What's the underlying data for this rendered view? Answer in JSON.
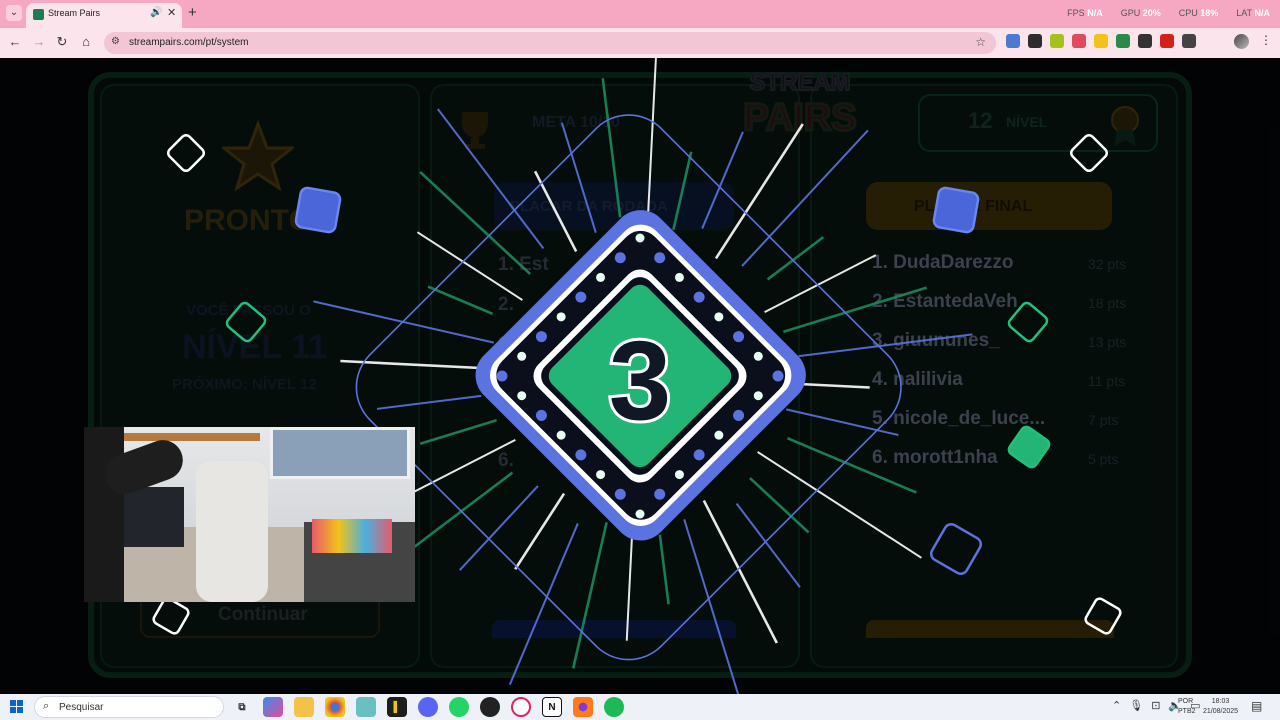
{
  "browser": {
    "tab_title": "Stream Pairs",
    "url": "streampairs.com/pt/system",
    "hud": {
      "fps_label": "FPS",
      "fps_value": "N/A",
      "gpu_label": "GPU",
      "gpu_value": "20%",
      "cpu_label": "CPU",
      "cpu_value": "18%",
      "lat_label": "LAT",
      "lat_value": "N/A"
    },
    "extension_colors": [
      "#4a7bd0",
      "#2d2d2d",
      "#a4c21a",
      "#e04a5a",
      "#f2c21a",
      "#2a8a4a",
      "#333333",
      "#d4201a",
      "#444444"
    ]
  },
  "game": {
    "countdown": "3",
    "ready_label": "PRONTO!",
    "level_passed_label": "VOCÊ PASSOU O",
    "level_label": "NÍVEL 11",
    "next_level_label": "PRÓXIMO: NÍVEL 12",
    "meta_label": "META",
    "meta_value": "10/10",
    "level_badge_number": "12",
    "level_badge_word": "NÍVEL",
    "placar_left_label": "PLACAR DA RODADA",
    "placar_final_label": "PLACAR FINAL",
    "continue_label": "Continuar",
    "logo_line1": "STREAM",
    "logo_line2": "PAIRS",
    "left_rows": [
      "1. Est",
      "2.",
      "3.",
      "6. "
    ],
    "ranking": [
      {
        "name": "1. DudaDarezzo",
        "pts": "32 pts"
      },
      {
        "name": "2. EstantedaVeh",
        "pts": "18 pts"
      },
      {
        "name": "3. giuununes_",
        "pts": "13 pts"
      },
      {
        "name": "4. nalilivia",
        "pts": "11 pts"
      },
      {
        "name": "5. nicole_de_luce...",
        "pts": "7 pts"
      },
      {
        "name": "6. morott1nha",
        "pts": "5 pts"
      }
    ],
    "accent_colors": {
      "blue": "#5a73e0",
      "green": "#22b575",
      "gold": "#c9a020"
    }
  },
  "taskbar": {
    "search_label": "Pesquisar",
    "lang_line1": "POR",
    "lang_line2": "PTB2",
    "time": "18:03",
    "date": "21/08/2025"
  }
}
